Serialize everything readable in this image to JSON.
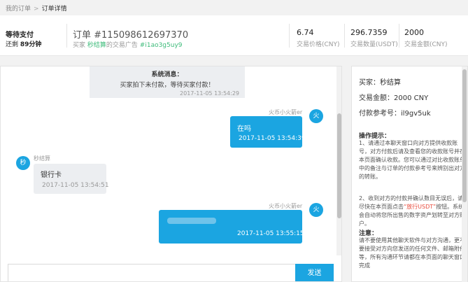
{
  "breadcrumb": {
    "parent": "我的订单",
    "separator": ">",
    "current": "订单详情"
  },
  "order": {
    "status": "等待支付",
    "countdown_prefix": "还剩",
    "countdown_value": "89分钟",
    "order_no": "订单 #115098612697370",
    "buyer_label": "买家",
    "buyer_name": "秒结算",
    "ad_label": "的交易广告",
    "ad_id": "#i1ao3g5uy9"
  },
  "stats": [
    {
      "value": "6.74",
      "label": "交易价格(CNY)"
    },
    {
      "value": "296.7359",
      "label": "交易数量(USDT)"
    },
    {
      "value": "2000",
      "label": "交易金额(CNY)"
    }
  ],
  "chat": {
    "system": {
      "title": "系统消息：",
      "text": "买家拍下未付款，等待买家付款！",
      "time": "2017-11-05 13:54:29"
    },
    "messages": [
      {
        "nick": "火币小火箭er",
        "avatar": "火",
        "text": "在吗",
        "time": "2017-11-05 13:54:39"
      },
      {
        "nick": "秒结算",
        "avatar": "秒",
        "text": "银行卡",
        "time": "2017-11-05 13:54:51"
      },
      {
        "nick": "火币小火箭er",
        "avatar": "火",
        "text": "",
        "time": "2017-11-05 13:55:15"
      }
    ],
    "send_label": "发送",
    "input_placeholder": ""
  },
  "info": {
    "buyer": "买家：秒结算",
    "amount": "交易金额：2000 CNY",
    "ref": "付款参考号：il9gv5uk",
    "tips_title": "操作提示：",
    "tip1": "1、请通过本聊天窗口向对方提供收款账号，对方付款后请及查看您的收款账号并在本页面确认收款。您可以通过对比收款账单中的备注与订单的付款参考号来辨别出对方的转账。",
    "tip2_a": "2、收到对方的付款并确认数目无误后，请尽快在本页面点击",
    "tip2_red": "“放行USDT”",
    "tip2_b": "按钮。系统会自动将您所出售的数字资产划转至对方账户。",
    "note_title": "注意：",
    "note": "请不要使用其他聊天软件与对方沟通，更不要接受对方向您发送的任何文件、邮箱附件等，所有沟通环节请都在本页面的聊天窗口完成"
  }
}
